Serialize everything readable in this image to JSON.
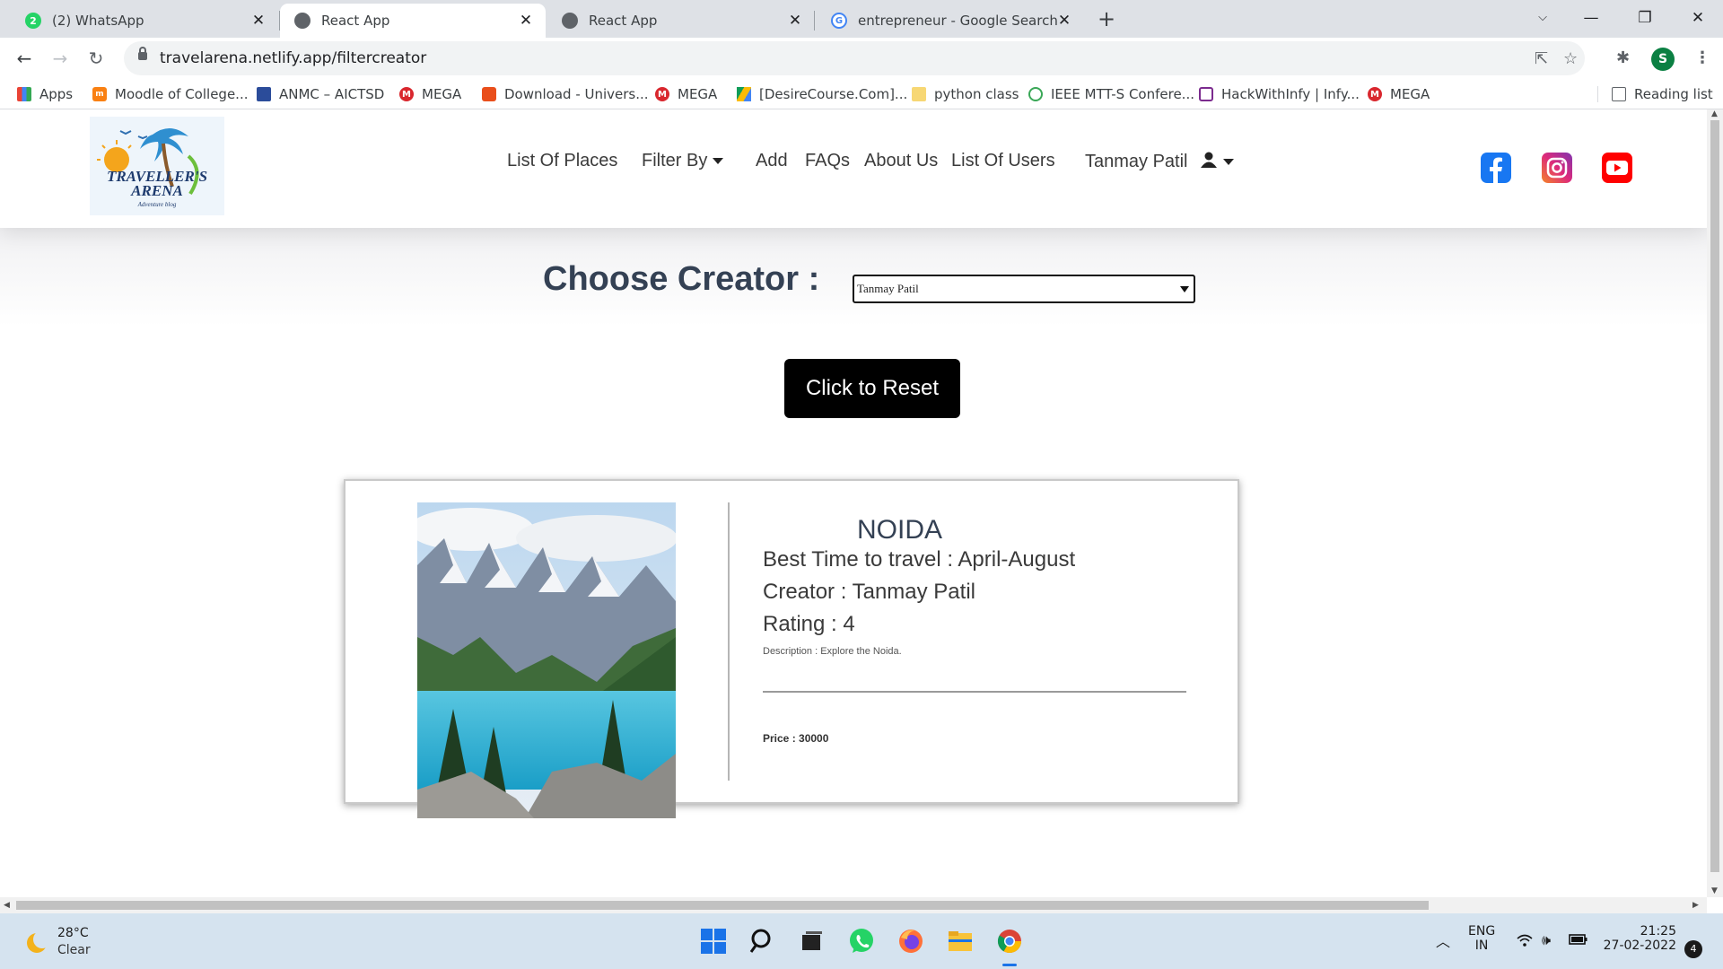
{
  "browser": {
    "tabs": [
      {
        "title": "(2) WhatsApp",
        "icon": "whatsapp-icon",
        "active": false
      },
      {
        "title": "React App",
        "icon": "globe-icon",
        "active": true
      },
      {
        "title": "React App",
        "icon": "globe-icon",
        "active": false
      },
      {
        "title": "entrepreneur - Google Search",
        "icon": "google-icon",
        "active": false
      }
    ],
    "whatsapp_badge": "2",
    "url": "travelarena.netlify.app/filtercreator",
    "profile_initial": "S",
    "bookmarks": [
      {
        "label": "Apps",
        "icon": "apps-grid-icon"
      },
      {
        "label": "Moodle of College...",
        "icon": "moodle-icon"
      },
      {
        "label": "ANMC – AICTSD",
        "icon": "anmc-icon"
      },
      {
        "label": "MEGA",
        "icon": "mega-icon"
      },
      {
        "label": "Download - Univers...",
        "icon": "download-univers-icon"
      },
      {
        "label": "MEGA",
        "icon": "mega-icon"
      },
      {
        "label": "[DesireCourse.Com]...",
        "icon": "google-drive-icon"
      },
      {
        "label": "python class",
        "icon": "folder-icon"
      },
      {
        "label": "IEEE MTT-S Confere...",
        "icon": "ieee-icon"
      },
      {
        "label": "HackWithInfy | Infy...",
        "icon": "hackwithinfy-icon"
      },
      {
        "label": "MEGA",
        "icon": "mega-icon"
      }
    ],
    "mega_letter": "M",
    "reading_list": "Reading list"
  },
  "site": {
    "logo_text_line1": "TRAVELLER'S",
    "logo_text_line2": "ARENA",
    "logo_tagline": "Adventure blog",
    "nav": {
      "list_of_places": "List Of Places",
      "filter_by": "Filter By",
      "add": "Add",
      "faqs": "FAQs",
      "about_us": "About Us",
      "list_of_users": "List Of Users",
      "user_name": "Tanmay Patil"
    },
    "social": [
      {
        "name": "facebook-icon",
        "color": "#1877f2"
      },
      {
        "name": "instagram-icon",
        "color": "#c13584"
      },
      {
        "name": "youtube-icon",
        "color": "#ff0000"
      }
    ]
  },
  "filter": {
    "label": "Choose Creator :",
    "selected_creator": "Tanmay Patil",
    "reset_label": "Click to Reset"
  },
  "place": {
    "name": "NOIDA",
    "best_time": "Best Time to travel : April-August",
    "creator": "Creator : Tanmay Patil",
    "rating": "Rating : 4",
    "description": "Description : Explore the Noida.",
    "price": "Price : 30000"
  },
  "taskbar": {
    "temperature": "28°C",
    "weather": "Clear",
    "lang_line1": "ENG",
    "lang_line2": "IN",
    "time": "21:25",
    "date": "27-02-2022",
    "notification_count": "4"
  }
}
